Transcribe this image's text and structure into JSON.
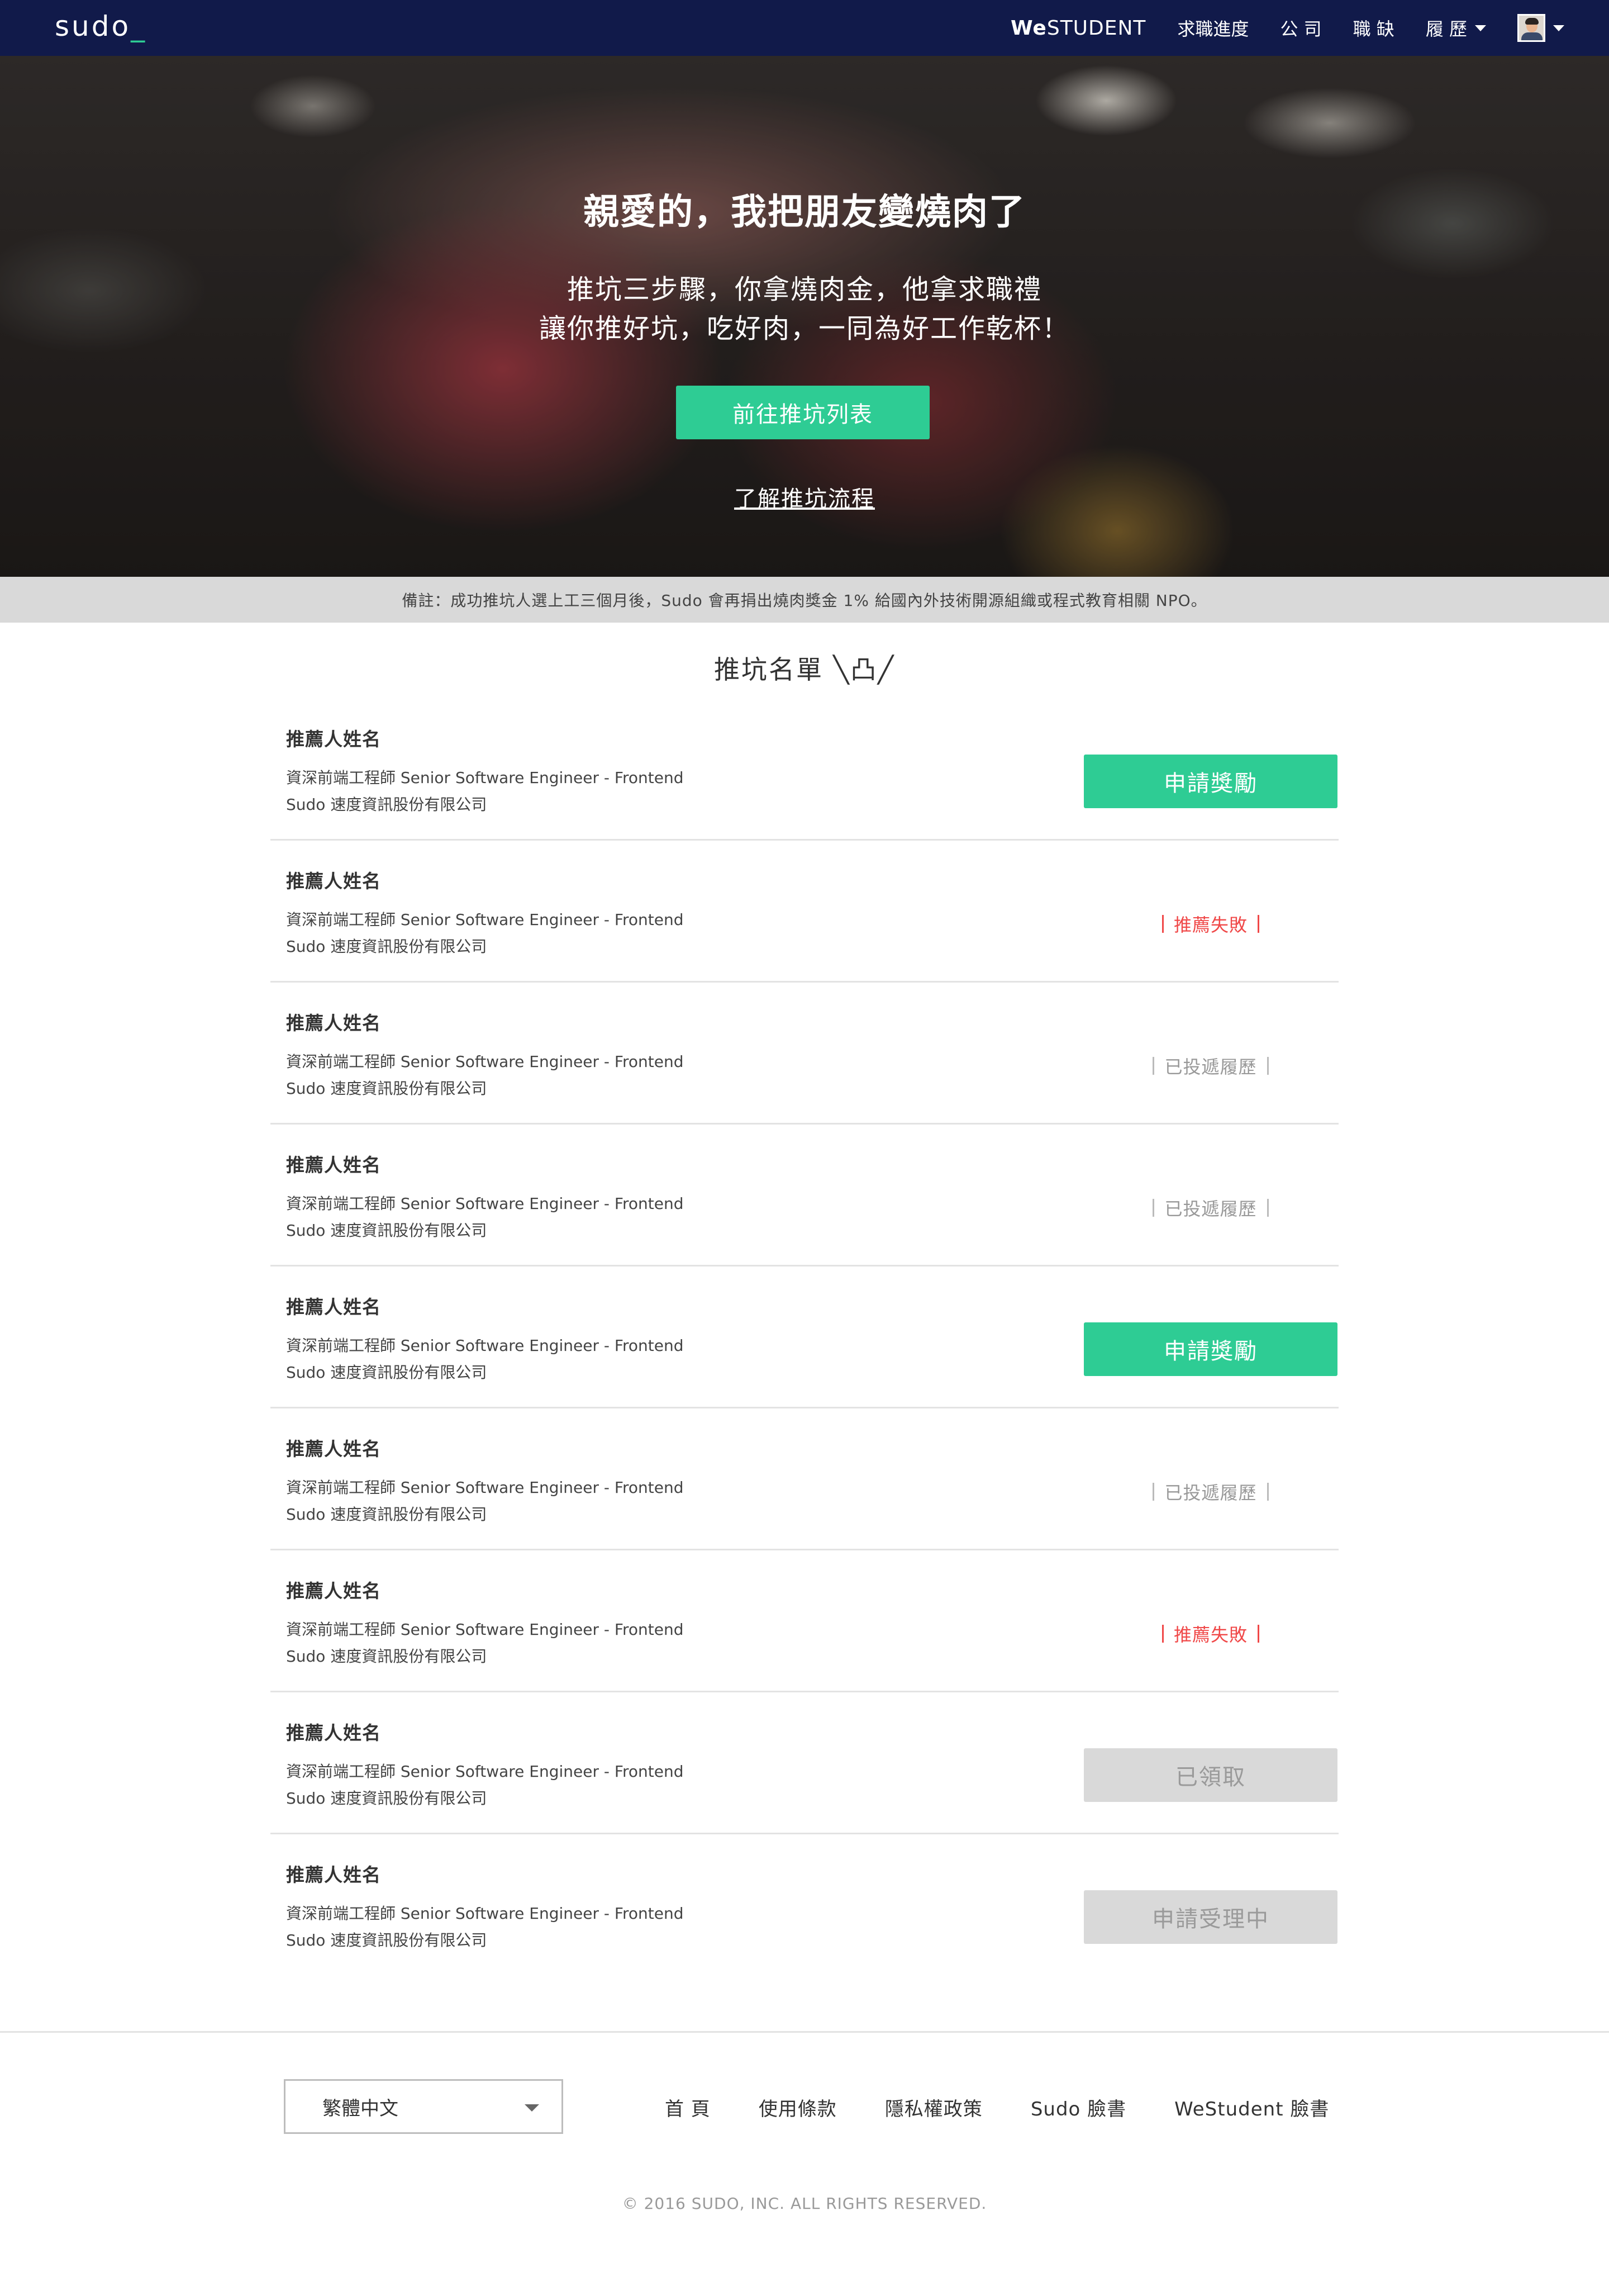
{
  "nav": {
    "logo": "sudo",
    "logo_cursor": "_",
    "brand_we": "We",
    "brand_student": "STUDENT",
    "links": [
      "求職進度",
      "公 司",
      "職 缺",
      "履 歷"
    ],
    "avatar": "user-avatar"
  },
  "hero": {
    "title": "親愛的，我把朋友變燒肉了",
    "subtitle_line1": "推坑三步驟，你拿燒肉金，他拿求職禮",
    "subtitle_line2": "讓你推好坑，吃好肉，一同為好工作乾杯！",
    "cta_label": "前往推坑列表",
    "link_label": "了解推坑流程"
  },
  "note": "備註：成功推坑人選上工三個月後，Sudo 會再捐出燒肉獎金 1% 給國內外技術開源組織或程式教育相關 NPO。",
  "list": {
    "title": "推坑名單 ╲凸╱",
    "rows": [
      {
        "name": "推薦人姓名",
        "job": "資深前端工程師 Senior Software Engineer - Frontend",
        "company": "Sudo 速度資訊股份有限公司",
        "status_type": "button",
        "status": "申請獎勵"
      },
      {
        "name": "推薦人姓名",
        "job": "資深前端工程師 Senior Software Engineer - Frontend",
        "company": "Sudo 速度資訊股份有限公司",
        "status_type": "fail",
        "status": "推薦失敗"
      },
      {
        "name": "推薦人姓名",
        "job": "資深前端工程師 Senior Software Engineer - Frontend",
        "company": "Sudo 速度資訊股份有限公司",
        "status_type": "sent",
        "status": "已投遞履歷"
      },
      {
        "name": "推薦人姓名",
        "job": "資深前端工程師 Senior Software Engineer - Frontend",
        "company": "Sudo 速度資訊股份有限公司",
        "status_type": "sent",
        "status": "已投遞履歷"
      },
      {
        "name": "推薦人姓名",
        "job": "資深前端工程師 Senior Software Engineer - Frontend",
        "company": "Sudo 速度資訊股份有限公司",
        "status_type": "button",
        "status": "申請獎勵"
      },
      {
        "name": "推薦人姓名",
        "job": "資深前端工程師 Senior Software Engineer - Frontend",
        "company": "Sudo 速度資訊股份有限公司",
        "status_type": "sent",
        "status": "已投遞履歷"
      },
      {
        "name": "推薦人姓名",
        "job": "資深前端工程師 Senior Software Engineer - Frontend",
        "company": "Sudo 速度資訊股份有限公司",
        "status_type": "fail",
        "status": "推薦失敗"
      },
      {
        "name": "推薦人姓名",
        "job": "資深前端工程師 Senior Software Engineer - Frontend",
        "company": "Sudo 速度資訊股份有限公司",
        "status_type": "disabled",
        "status": "已領取"
      },
      {
        "name": "推薦人姓名",
        "job": "資深前端工程師 Senior Software Engineer - Frontend",
        "company": "Sudo 速度資訊股份有限公司",
        "status_type": "disabled",
        "status": "申請受理中"
      }
    ]
  },
  "footer": {
    "language": "繁體中文",
    "links": [
      "首 頁",
      "使用條款",
      "隱私權政策",
      "Sudo 臉書",
      "WeStudent 臉書"
    ],
    "copyright": "© 2016 SUDO, INC. ALL RIGHTS RESERVED."
  },
  "colors": {
    "nav_bg": "#111a4a",
    "accent": "#2ecc94",
    "fail": "#f04848",
    "muted": "#999999",
    "disabled_bg": "#d9d9d9"
  }
}
